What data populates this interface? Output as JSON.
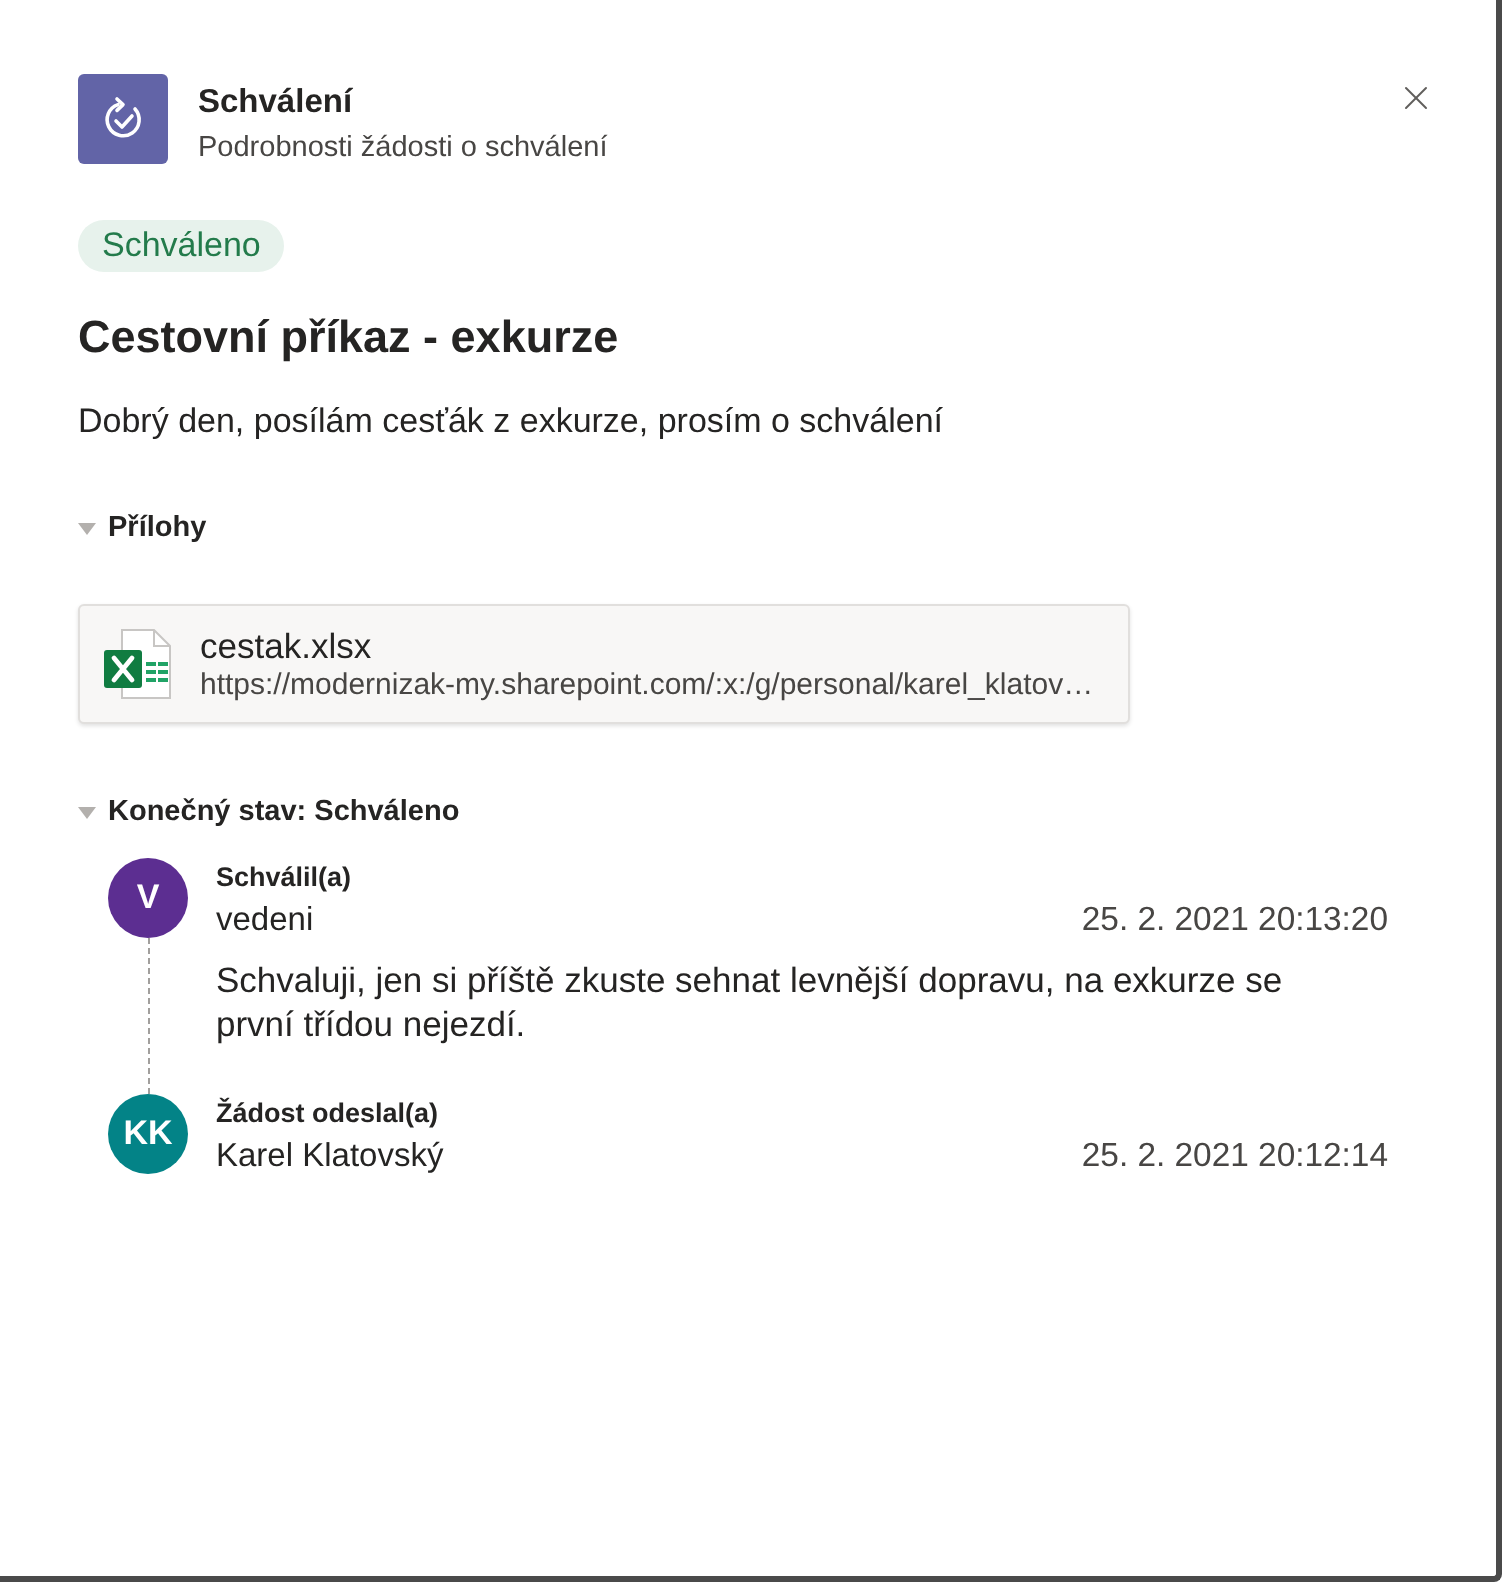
{
  "header": {
    "title": "Schválení",
    "subtitle": "Podrobnosti žádosti o schválení"
  },
  "status_badge": {
    "label": "Schváleno",
    "kind": "approved"
  },
  "request": {
    "title": "Cestovní příkaz - exkurze",
    "description": "Dobrý den, posílám cesťák z exkurze, prosím o schválení"
  },
  "attachments": {
    "label": "Přílohy",
    "expanded": true,
    "files": [
      {
        "kind": "excel",
        "name": "cestak.xlsx",
        "url": "https://modernizak-my.sharepoint.com/:x:/g/personal/karel_klatov…"
      }
    ]
  },
  "final_status": {
    "label": "Konečný stav: Schváleno",
    "expanded": true,
    "timeline": [
      {
        "role": "Schválil(a)",
        "initials": "V",
        "color": "#5c2e91",
        "name": "vedeni",
        "time": "25. 2. 2021 20:13:20",
        "comment": "Schvaluji, jen si příště zkuste sehnat levnější dopravu, na exkurze se první třídou nejezdí."
      },
      {
        "role": "Žádost odeslal(a)",
        "initials": "KK",
        "color": "#038387",
        "name": "Karel Klatovský",
        "time": "25. 2. 2021 20:12:14"
      }
    ]
  }
}
